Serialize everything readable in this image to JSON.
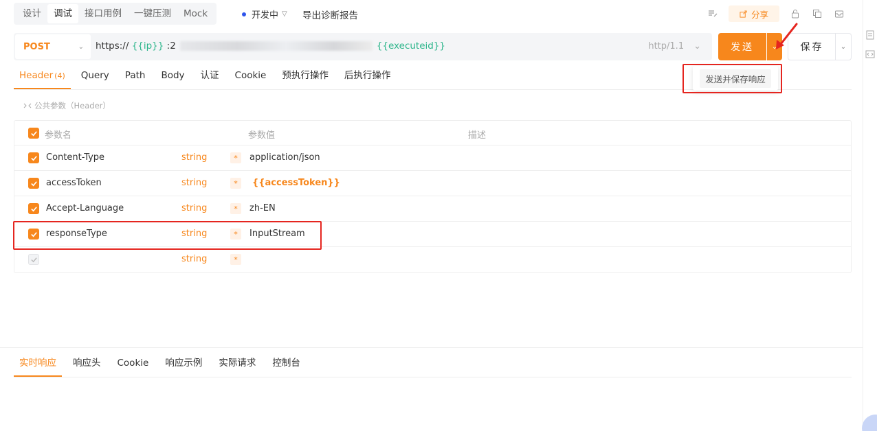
{
  "mode_tabs": [
    {
      "label": "设计",
      "active": false
    },
    {
      "label": "调试",
      "active": true
    },
    {
      "label": "接口用例",
      "active": false
    },
    {
      "label": "一键压测",
      "active": false
    },
    {
      "label": "Mock",
      "active": false
    }
  ],
  "environment": {
    "label": "开发中",
    "dot_color": "#2f54eb"
  },
  "export_label": "导出诊断报告",
  "share_label": "分享",
  "request": {
    "method": "POST",
    "url_prefix": "https://",
    "url_var_ip": "{{ip}}",
    "url_port": ":2",
    "url_var_executeid": "{{executeid}}",
    "protocol": "http/1.1"
  },
  "send_label": "发送",
  "save_label": "保存",
  "send_menu_option": "发送并保存响应",
  "request_tabs": [
    {
      "label": "Header",
      "count": "(4)",
      "active": true
    },
    {
      "label": "Query"
    },
    {
      "label": "Path"
    },
    {
      "label": "Body"
    },
    {
      "label": "认证"
    },
    {
      "label": "Cookie"
    },
    {
      "label": "预执行操作"
    },
    {
      "label": "后执行操作"
    }
  ],
  "public_params_label": "公共参数（Header）",
  "table": {
    "headers": {
      "name": "参数名",
      "value": "参数值",
      "desc": "描述"
    },
    "rows": [
      {
        "name": "Content-Type",
        "type": "string",
        "required": "*",
        "value": "application/json",
        "checked": true
      },
      {
        "name": "accessToken",
        "type": "string",
        "required": "*",
        "value": "{{accessToken}}",
        "checked": true
      },
      {
        "name": "Accept-Language",
        "type": "string",
        "required": "*",
        "value": "zh-EN",
        "checked": true
      },
      {
        "name": "responseType",
        "type": "string",
        "required": "*",
        "value": "InputStream",
        "checked": true
      },
      {
        "name": "",
        "type": "string",
        "required": "*",
        "value": "",
        "checked": false
      }
    ]
  },
  "response_tabs": [
    {
      "label": "实时响应",
      "active": true
    },
    {
      "label": "响应头"
    },
    {
      "label": "Cookie"
    },
    {
      "label": "响应示例"
    },
    {
      "label": "实际请求"
    },
    {
      "label": "控制台"
    }
  ],
  "colors": {
    "accent": "#f7871c",
    "variable": "#2bb58a",
    "highlight": "#e5251f"
  }
}
